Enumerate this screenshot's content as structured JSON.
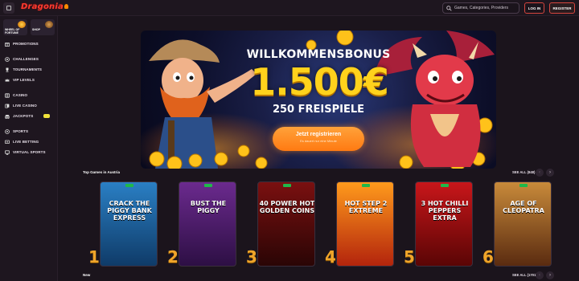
{
  "header": {
    "logo_text": "Dragonia",
    "search_placeholder": "Games, Categories, Providers",
    "login_label": "LOG IN",
    "register_label": "REGISTER"
  },
  "sidebar": {
    "promo_tiles": [
      {
        "label": "WHEEL OF FORTUNE"
      },
      {
        "label": "SHOP"
      }
    ],
    "groups": [
      [
        {
          "label": "PROMOTIONS",
          "icon": "gift-icon"
        },
        {
          "label": "CHALLENGES",
          "icon": "target-icon"
        },
        {
          "label": "TOURNAMENTS",
          "icon": "trophy-icon"
        },
        {
          "label": "VIP LEVELS",
          "icon": "crown-icon"
        }
      ],
      [
        {
          "label": "CASINO",
          "icon": "slot-icon"
        },
        {
          "label": "LIVE CASINO",
          "icon": "cards-icon"
        },
        {
          "label": "JACKPOTS",
          "icon": "coins-icon",
          "badge": true
        }
      ],
      [
        {
          "label": "SPORTS",
          "icon": "ball-icon"
        },
        {
          "label": "LIVE BETTING",
          "icon": "live-icon"
        },
        {
          "label": "VIRTUAL SPORTS",
          "icon": "monitor-icon"
        }
      ]
    ]
  },
  "hero": {
    "headline": "WILLKOMMENSBONUS",
    "amount": "1.500€",
    "spins": "250 FREISPIELE",
    "cta_label": "Jetzt registrieren",
    "cta_sub": "Es dauert nur eine Minute"
  },
  "top_games": {
    "title": "Top Games in Austria",
    "see_all": "SEE ALL (848)",
    "games": [
      {
        "rank": "1",
        "title": "CRACK THE PIGGY BANK EXPRESS",
        "top": "#2a7fc4",
        "bottom": "#0f3b68"
      },
      {
        "rank": "2",
        "title": "BUST THE PIGGY",
        "top": "#6b2a8e",
        "bottom": "#2d0f44"
      },
      {
        "rank": "3",
        "title": "40 POWER HOT GOLDEN COINS",
        "top": "#7a1010",
        "bottom": "#2a0505"
      },
      {
        "rank": "4",
        "title": "HOT STEP 2 EXTREME",
        "top": "#ff9a1c",
        "bottom": "#b3240c"
      },
      {
        "rank": "5",
        "title": "3 HOT CHILLI PEPPERS EXTRA",
        "top": "#c8161a",
        "bottom": "#5a0505"
      },
      {
        "rank": "6",
        "title": "AGE OF CLEOPATRA",
        "top": "#c88a3a",
        "bottom": "#5a2b10"
      }
    ]
  },
  "new_games": {
    "title": "New",
    "see_all": "SEE ALL (1701)"
  }
}
